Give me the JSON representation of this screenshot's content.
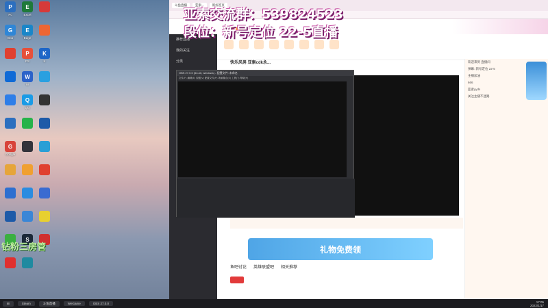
{
  "overlay": {
    "line1": "亚索交流群：539824523",
    "line2": "段位：新号定位 22-5直播",
    "bottom_left": "钻粉三房管"
  },
  "desktop": {
    "icons": [
      {
        "label": "Pc",
        "color": "#2c6fbf"
      },
      {
        "label": "Excel",
        "color": "#1f7a3a"
      },
      {
        "label": "",
        "color": "#d63a3a"
      },
      {
        "label": "Goo",
        "color": "#2f86d6"
      },
      {
        "label": "Edge",
        "color": "#1a86c8"
      },
      {
        "label": "",
        "color": "#ee6633"
      },
      {
        "label": "",
        "color": "#e0402f"
      },
      {
        "label": "PS",
        "color": "#e6503a"
      },
      {
        "label": "K",
        "color": "#1e66c7"
      },
      {
        "label": "",
        "color": "#0f6ad6"
      },
      {
        "label": "W",
        "color": "#2b62c9"
      },
      {
        "label": "",
        "color": "#2aa0e0"
      },
      {
        "label": "",
        "color": "#2e7ee8"
      },
      {
        "label": "QQ",
        "color": "#1a9be6"
      },
      {
        "label": "",
        "color": "#333"
      },
      {
        "label": "",
        "color": "#2c6fbf"
      },
      {
        "label": "",
        "color": "#26b34a"
      },
      {
        "label": "",
        "color": "#1e5aa8"
      },
      {
        "label": "Google",
        "color": "#d8443a"
      },
      {
        "label": "",
        "color": "#33333a"
      },
      {
        "label": "",
        "color": "#2a9fd6"
      },
      {
        "label": "",
        "color": "#e6a53a"
      },
      {
        "label": "",
        "color": "#f0a030"
      },
      {
        "label": "",
        "color": "#e0402f"
      },
      {
        "label": "",
        "color": "#2d6fd0"
      },
      {
        "label": "",
        "color": "#2a8ce0"
      },
      {
        "label": "",
        "color": "#3a6bd1"
      },
      {
        "label": "",
        "color": "#1c5aa8"
      },
      {
        "label": "",
        "color": "#3a86d6"
      },
      {
        "label": "",
        "color": "#e8d030"
      },
      {
        "label": "",
        "color": "#3ab040"
      },
      {
        "label": "Steam",
        "color": "#1b2838"
      },
      {
        "label": "",
        "color": "#d03030"
      },
      {
        "label": "",
        "color": "#e0302f"
      },
      {
        "label": "",
        "color": "#1f8aa0"
      }
    ]
  },
  "browser": {
    "tabs": [
      "斗鱼直播",
      "亚索...",
      "新标签页"
    ],
    "site_brand": "斗鱼直播",
    "room_title": "快乐风男 亚索cdk永...",
    "left_menu": [
      "推荐直播",
      "我的关注",
      "分类",
      "直播间"
    ],
    "chat": [
      "欢迎来到 直播间",
      "弹幕: 新号定位 22-5",
      "主播加油",
      "666",
      "亚索yyds",
      "关注主播不迷路"
    ],
    "promo_text": "礼物免费领",
    "content_tabs": [
      "鱼吧讨论",
      "英雄联盟吧",
      "相关推荐"
    ]
  },
  "obs": {
    "title": "OBS 27.0.0 (64-bit, windows) - 配置文件: 未命名",
    "menu": "文件(F) 编辑(E) 视图(V) 配置文件(P) 场景集合(S) 工具(T) 帮助(H)"
  },
  "taskbar": {
    "items": [
      "Steam",
      "斗鱼直播",
      "WeGame",
      "OBS 27.0.0"
    ],
    "time": "17:05",
    "date": "2022/1/17"
  }
}
